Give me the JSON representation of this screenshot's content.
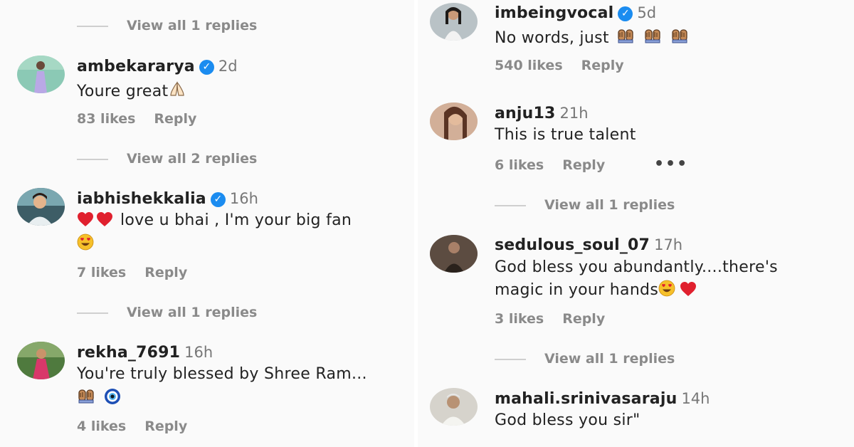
{
  "left": {
    "top_view_replies": "View all 1 replies",
    "comments": [
      {
        "username": "ambekararya",
        "verified": true,
        "time": "2d",
        "text": "Youre great",
        "likes": "83 likes",
        "reply": "Reply",
        "view_replies": "View all 2 replies"
      },
      {
        "username": "iabhishekkalia",
        "verified": true,
        "time": "16h",
        "text": "love u bhai , I'm your big fan",
        "likes": "7 likes",
        "reply": "Reply",
        "view_replies": "View all 1 replies"
      },
      {
        "username": "rekha_7691",
        "verified": false,
        "time": "16h",
        "text": "You're truly blessed by Shree Ram...",
        "likes": "4 likes",
        "reply": "Reply"
      }
    ]
  },
  "right": {
    "comments": [
      {
        "username": "imbeingvocal",
        "verified": true,
        "time": "5d",
        "text": "No words, just",
        "likes": "540 likes",
        "reply": "Reply"
      },
      {
        "username": "anju13",
        "verified": false,
        "time": "21h",
        "text": "This is true talent",
        "likes": "6 likes",
        "reply": "Reply",
        "more": "•••",
        "view_replies": "View all 1 replies"
      },
      {
        "username": "sedulous_soul_07",
        "verified": false,
        "time": "17h",
        "text": "God bless you abundantly....there's",
        "text_line2": "magic in your hands",
        "likes": "3 likes",
        "reply": "Reply",
        "view_replies": "View all 1 replies"
      },
      {
        "username": "mahali.srinivasaraju",
        "verified": false,
        "time": "14h",
        "text": "God bless you sir\""
      }
    ]
  },
  "icons": {
    "verified": "verified-badge-icon",
    "heart": "red-heart-emoji",
    "heart_eyes": "heart-eyes-emoji",
    "folded_hands": "folded-hands-emoji",
    "raised_hands": "raised-hands-emoji",
    "evil_eye": "nazar-amulet-emoji"
  },
  "colors": {
    "background": "#fafafa",
    "verified_blue": "#1b8cf0",
    "muted_text": "#8a8a8a",
    "heart_red": "#e0202e"
  }
}
